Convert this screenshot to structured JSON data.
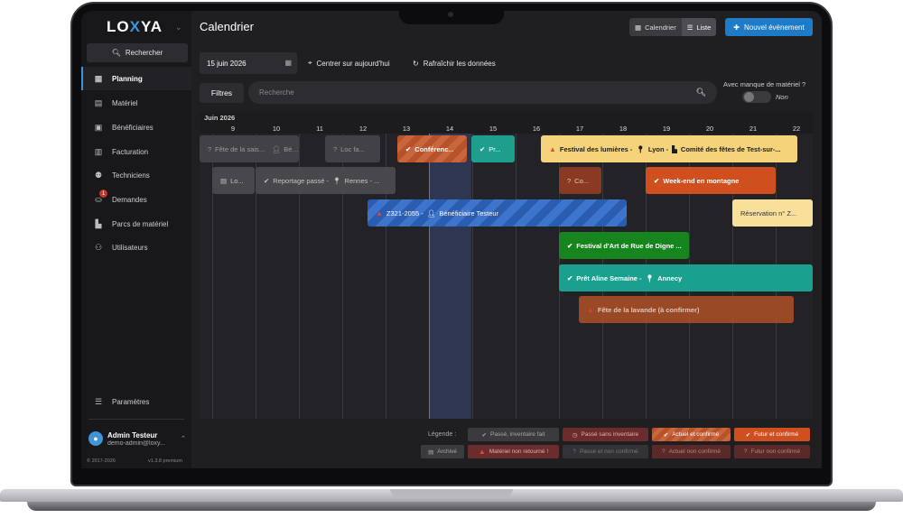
{
  "brand": {
    "logo_pre": "LO",
    "logo_x": "X",
    "logo_post": "YA",
    "accent": "#3e95d8"
  },
  "sidebar": {
    "search_label": "Rechercher",
    "items": [
      {
        "label": "Planning",
        "icon": "calendar-icon"
      },
      {
        "label": "Matériel",
        "icon": "box-icon"
      },
      {
        "label": "Bénéficiaires",
        "icon": "contact-card-icon"
      },
      {
        "label": "Facturation",
        "icon": "invoice-icon"
      },
      {
        "label": "Techniciens",
        "icon": "people-icon"
      },
      {
        "label": "Demandes",
        "icon": "basket-icon",
        "badge": "1"
      },
      {
        "label": "Parcs de matériel",
        "icon": "industry-icon"
      },
      {
        "label": "Utilisateurs",
        "icon": "users-icon"
      }
    ],
    "settings_label": "Paramètres",
    "user": {
      "name": "Admin Testeur",
      "email": "demo-admin@loxy..."
    },
    "copyright": "© 2017-2026",
    "version": "v1.3.8 premium"
  },
  "header": {
    "title": "Calendrier",
    "view_calendar": "Calendrier",
    "view_list": "Liste",
    "new_event": "Nouvel événement"
  },
  "toolbar": {
    "date": "15 juin 2026",
    "center_today": "Centrer sur aujourd'hui",
    "refresh": "Rafraîchir les données",
    "filters": "Filtres",
    "search_placeholder": "Recherche",
    "missing_label": "Avec manque de matériel ?",
    "missing_value": "Non"
  },
  "timeline": {
    "month": "Juin 2026",
    "days": [
      "9",
      "10",
      "11",
      "12",
      "13",
      "14",
      "15",
      "16",
      "17",
      "18",
      "19",
      "20",
      "21",
      "22"
    ],
    "events": [
      {
        "label": "Fête de la saison - ",
        "extra": "Béné",
        "status": "grey"
      },
      {
        "label": "Loc fa...",
        "status": "grey"
      },
      {
        "label": "Conférenc...",
        "status": "orange-stripe"
      },
      {
        "label": "Pr...",
        "status": "teal"
      },
      {
        "label": "Festival des lumières -",
        "place": "Lyon -",
        "org": "Comité des fêtes de Test-sur-...",
        "status": "yellow"
      },
      {
        "label": "Lo...",
        "status": "grey2"
      },
      {
        "label": "Reportage passé -",
        "place": "Rennes - ...",
        "status": "grey2"
      },
      {
        "label": "Co...",
        "status": "orange-dim"
      },
      {
        "label": "Week-end en montagne",
        "status": "orange"
      },
      {
        "label": "Z321-2055 -",
        "benef": "Bénéficiaire Testeur",
        "status": "blue-stripe"
      },
      {
        "label": "Réservation n° Z...",
        "status": "yellow-light"
      },
      {
        "label": "Festival d'Art de Rue de Digne ...",
        "status": "green"
      },
      {
        "label": "Prêt Aline Semaine -",
        "place": "Annecy",
        "status": "teal"
      },
      {
        "label": "Fête de la lavande (à confirmer)",
        "status": "orange-fade"
      }
    ]
  },
  "legend": {
    "label": "Légende :",
    "items": [
      "Passé, inventaire fait",
      "Passé sans inventaire",
      "Actuel et confirmé",
      "Futur et confirmé",
      "Archivé",
      "Matériel non retourné !",
      "Passé et non confirmé",
      "Actuel non confirmé",
      "Futur non confirmé"
    ]
  }
}
